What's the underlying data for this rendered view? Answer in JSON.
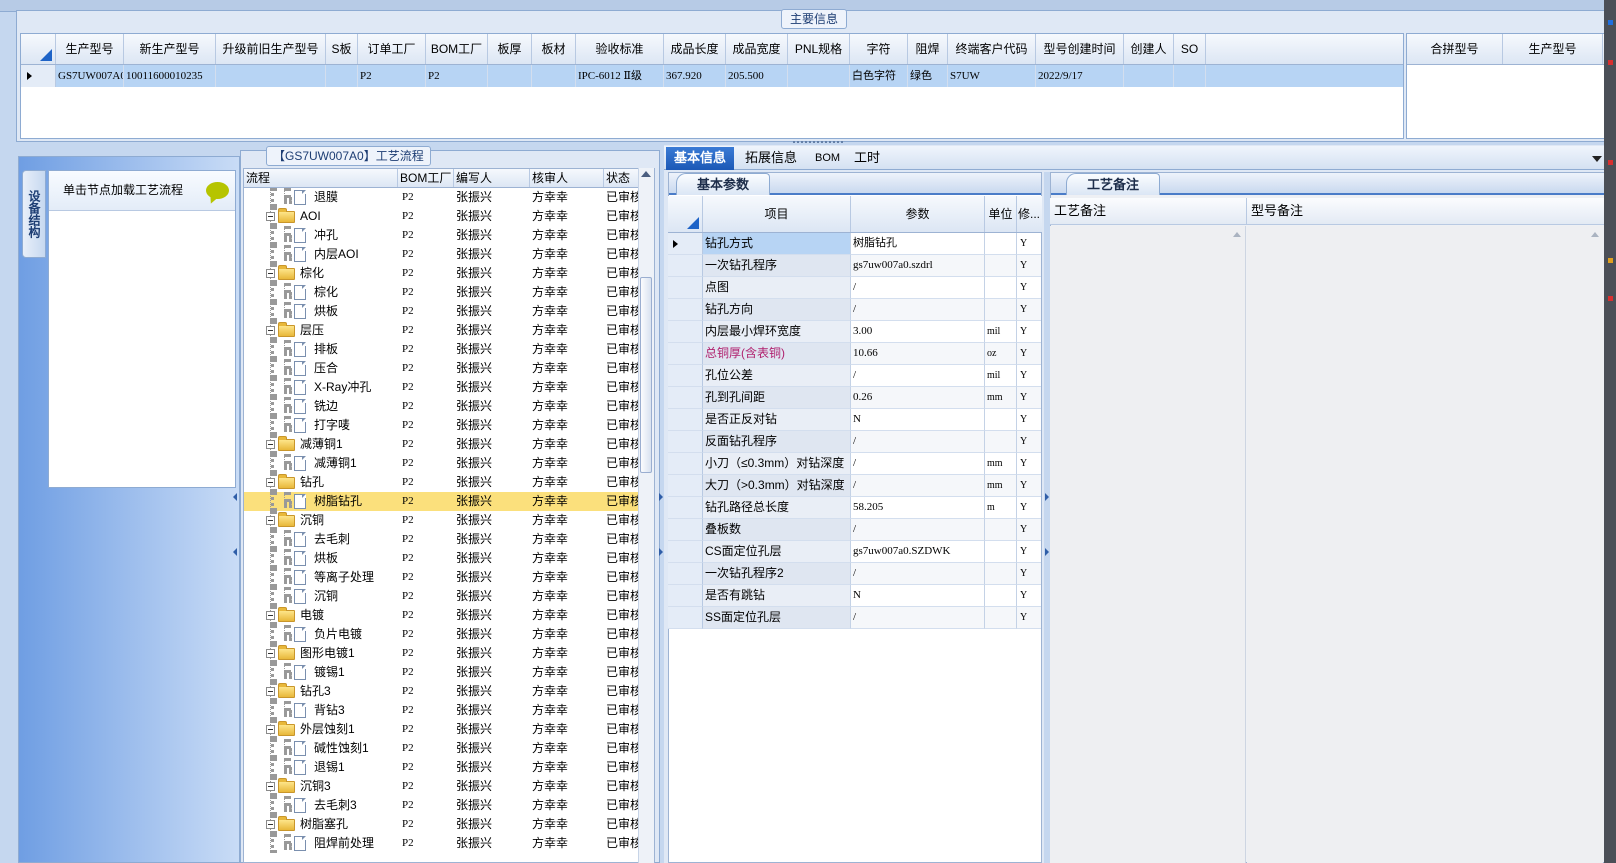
{
  "main_info": {
    "legend": "主要信息",
    "columns": [
      "生产型号",
      "新生产型号",
      "升级前旧生产型号",
      "S板",
      "订单工厂",
      "BOM工厂",
      "板厚",
      "板材",
      "验收标准",
      "成品长度",
      "成品宽度",
      "PNL规格",
      "字符",
      "阻焊",
      "终端客户代码",
      "型号创建时间",
      "创建人",
      "SO"
    ],
    "row": [
      "GS7UW007A0",
      "10011600010235",
      "",
      "",
      "P2",
      "P2",
      "",
      "",
      "IPC-6012 Ⅱ级",
      "367.920",
      "205.500",
      "",
      "白色字符",
      "绿色",
      "S7UW",
      "2022/9/17",
      "",
      ""
    ],
    "merge_columns": [
      "合拼型号",
      "生产型号"
    ]
  },
  "device_structure": {
    "tab_label": "设备结构",
    "hint": "单击节点加载工艺流程"
  },
  "process_flow": {
    "legend": "【GS7UW007A0】工艺流程",
    "columns": [
      "流程",
      "BOM工厂",
      "编写人",
      "核审人",
      "状态"
    ],
    "rows": [
      {
        "level": 1,
        "type": "doc",
        "name": "退膜",
        "bom": "P2",
        "writer": "张振兴",
        "reviewer": "方幸幸",
        "status": "已审核"
      },
      {
        "level": 0,
        "type": "folder",
        "name": "AOI",
        "bom": "P2",
        "writer": "张振兴",
        "reviewer": "方幸幸",
        "status": "已审核"
      },
      {
        "level": 1,
        "type": "doc",
        "name": "冲孔",
        "bom": "P2",
        "writer": "张振兴",
        "reviewer": "方幸幸",
        "status": "已审核"
      },
      {
        "level": 1,
        "type": "doc",
        "name": "内层AOI",
        "bom": "P2",
        "writer": "张振兴",
        "reviewer": "方幸幸",
        "status": "已审核"
      },
      {
        "level": 0,
        "type": "folder",
        "name": "棕化",
        "bom": "P2",
        "writer": "张振兴",
        "reviewer": "方幸幸",
        "status": "已审核"
      },
      {
        "level": 1,
        "type": "doc",
        "name": "棕化",
        "bom": "P2",
        "writer": "张振兴",
        "reviewer": "方幸幸",
        "status": "已审核"
      },
      {
        "level": 1,
        "type": "doc",
        "name": "烘板",
        "bom": "P2",
        "writer": "张振兴",
        "reviewer": "方幸幸",
        "status": "已审核"
      },
      {
        "level": 0,
        "type": "folder",
        "name": "层压",
        "bom": "P2",
        "writer": "张振兴",
        "reviewer": "方幸幸",
        "status": "已审核"
      },
      {
        "level": 1,
        "type": "doc",
        "name": "排板",
        "bom": "P2",
        "writer": "张振兴",
        "reviewer": "方幸幸",
        "status": "已审核"
      },
      {
        "level": 1,
        "type": "doc",
        "name": "压合",
        "bom": "P2",
        "writer": "张振兴",
        "reviewer": "方幸幸",
        "status": "已审核"
      },
      {
        "level": 1,
        "type": "doc",
        "name": "X-Ray冲孔",
        "bom": "P2",
        "writer": "张振兴",
        "reviewer": "方幸幸",
        "status": "已审核"
      },
      {
        "level": 1,
        "type": "doc",
        "name": "铣边",
        "bom": "P2",
        "writer": "张振兴",
        "reviewer": "方幸幸",
        "status": "已审核"
      },
      {
        "level": 1,
        "type": "doc",
        "name": "打字唛",
        "bom": "P2",
        "writer": "张振兴",
        "reviewer": "方幸幸",
        "status": "已审核"
      },
      {
        "level": 0,
        "type": "folder",
        "name": "减薄铜1",
        "bom": "P2",
        "writer": "张振兴",
        "reviewer": "方幸幸",
        "status": "已审核"
      },
      {
        "level": 1,
        "type": "doc",
        "name": "减薄铜1",
        "bom": "P2",
        "writer": "张振兴",
        "reviewer": "方幸幸",
        "status": "已审核"
      },
      {
        "level": 0,
        "type": "folder",
        "name": "钻孔",
        "bom": "P2",
        "writer": "张振兴",
        "reviewer": "方幸幸",
        "status": "已审核"
      },
      {
        "level": 1,
        "type": "doc",
        "name": "树脂钻孔",
        "bom": "P2",
        "writer": "张振兴",
        "reviewer": "方幸幸",
        "status": "已审核",
        "selected": true
      },
      {
        "level": 0,
        "type": "folder",
        "name": "沉铜",
        "bom": "P2",
        "writer": "张振兴",
        "reviewer": "方幸幸",
        "status": "已审核"
      },
      {
        "level": 1,
        "type": "doc",
        "name": "去毛刺",
        "bom": "P2",
        "writer": "张振兴",
        "reviewer": "方幸幸",
        "status": "已审核"
      },
      {
        "level": 1,
        "type": "doc",
        "name": "烘板",
        "bom": "P2",
        "writer": "张振兴",
        "reviewer": "方幸幸",
        "status": "已审核"
      },
      {
        "level": 1,
        "type": "doc",
        "name": "等离子处理",
        "bom": "P2",
        "writer": "张振兴",
        "reviewer": "方幸幸",
        "status": "已审核"
      },
      {
        "level": 1,
        "type": "doc",
        "name": "沉铜",
        "bom": "P2",
        "writer": "张振兴",
        "reviewer": "方幸幸",
        "status": "已审核"
      },
      {
        "level": 0,
        "type": "folder",
        "name": "电镀",
        "bom": "P2",
        "writer": "张振兴",
        "reviewer": "方幸幸",
        "status": "已审核"
      },
      {
        "level": 1,
        "type": "doc",
        "name": "负片电镀",
        "bom": "P2",
        "writer": "张振兴",
        "reviewer": "方幸幸",
        "status": "已审核"
      },
      {
        "level": 0,
        "type": "folder",
        "name": "图形电镀1",
        "bom": "P2",
        "writer": "张振兴",
        "reviewer": "方幸幸",
        "status": "已审核"
      },
      {
        "level": 1,
        "type": "doc",
        "name": "镀锡1",
        "bom": "P2",
        "writer": "张振兴",
        "reviewer": "方幸幸",
        "status": "已审核"
      },
      {
        "level": 0,
        "type": "folder",
        "name": "钻孔3",
        "bom": "P2",
        "writer": "张振兴",
        "reviewer": "方幸幸",
        "status": "已审核"
      },
      {
        "level": 1,
        "type": "doc",
        "name": "背钻3",
        "bom": "P2",
        "writer": "张振兴",
        "reviewer": "方幸幸",
        "status": "已审核"
      },
      {
        "level": 0,
        "type": "folder",
        "name": "外层蚀刻1",
        "bom": "P2",
        "writer": "张振兴",
        "reviewer": "方幸幸",
        "status": "已审核"
      },
      {
        "level": 1,
        "type": "doc",
        "name": "碱性蚀刻1",
        "bom": "P2",
        "writer": "张振兴",
        "reviewer": "方幸幸",
        "status": "已审核"
      },
      {
        "level": 1,
        "type": "doc",
        "name": "退锡1",
        "bom": "P2",
        "writer": "张振兴",
        "reviewer": "方幸幸",
        "status": "已审核"
      },
      {
        "level": 0,
        "type": "folder",
        "name": "沉铜3",
        "bom": "P2",
        "writer": "张振兴",
        "reviewer": "方幸幸",
        "status": "已审核"
      },
      {
        "level": 1,
        "type": "doc",
        "name": "去毛刺3",
        "bom": "P2",
        "writer": "张振兴",
        "reviewer": "方幸幸",
        "status": "已审核"
      },
      {
        "level": 0,
        "type": "folder",
        "name": "树脂塞孔",
        "bom": "P2",
        "writer": "张振兴",
        "reviewer": "方幸幸",
        "status": "已审核"
      },
      {
        "level": 1,
        "type": "doc",
        "name": "阻焊前处理",
        "bom": "P2",
        "writer": "张振兴",
        "reviewer": "方幸幸",
        "status": "已审核"
      }
    ]
  },
  "right_tabs": [
    "基本信息",
    "拓展信息",
    "BOM",
    "工时"
  ],
  "basic_params": {
    "tab_label": "基本参数",
    "columns": [
      "项目",
      "参数",
      "单位",
      "修..."
    ],
    "rows": [
      {
        "item": "钻孔方式",
        "value": "树脂钻孔",
        "unit": "",
        "mod": "Y",
        "current": true
      },
      {
        "item": "一次钻孔程序",
        "value": "gs7uw007a0.szdrl",
        "unit": "",
        "mod": "Y"
      },
      {
        "item": "点图",
        "value": "/",
        "unit": "",
        "mod": "Y"
      },
      {
        "item": "钻孔方向",
        "value": "/",
        "unit": "",
        "mod": "Y"
      },
      {
        "item": "内层最小焊环宽度",
        "value": "3.00",
        "unit": "mil",
        "mod": "Y"
      },
      {
        "item": "总铜厚(含表铜)",
        "value": "10.66",
        "unit": "oz",
        "mod": "Y",
        "highlight": true
      },
      {
        "item": "孔位公差",
        "value": "/",
        "unit": "mil",
        "mod": "Y"
      },
      {
        "item": "孔到孔间距",
        "value": "0.26",
        "unit": "mm",
        "mod": "Y"
      },
      {
        "item": "是否正反对钻",
        "value": "N",
        "unit": "",
        "mod": "Y"
      },
      {
        "item": "反面钻孔程序",
        "value": "/",
        "unit": "",
        "mod": "Y"
      },
      {
        "item": "小刀（≤0.3mm）对钻深度",
        "value": "/",
        "unit": "mm",
        "mod": "Y"
      },
      {
        "item": "大刀（>0.3mm）对钻深度",
        "value": "/",
        "unit": "mm",
        "mod": "Y"
      },
      {
        "item": "钻孔路径总长度",
        "value": "58.205",
        "unit": "m",
        "mod": "Y"
      },
      {
        "item": "叠板数",
        "value": "/",
        "unit": "",
        "mod": "Y"
      },
      {
        "item": "CS面定位孔层",
        "value": "gs7uw007a0.SZDWK",
        "unit": "",
        "mod": "Y"
      },
      {
        "item": "一次钻孔程序2",
        "value": "/",
        "unit": "",
        "mod": "Y"
      },
      {
        "item": "是否有跳钻",
        "value": "N",
        "unit": "",
        "mod": "Y"
      },
      {
        "item": "SS面定位孔层",
        "value": "/",
        "unit": "",
        "mod": "Y"
      }
    ]
  },
  "remarks": {
    "tab_label": "工艺备注",
    "columns": [
      "工艺备注",
      "型号备注"
    ]
  },
  "colors": {
    "highlight_text": "#b0206e",
    "selected_row": "#fbe07c",
    "active_tab": "#1b58b6"
  }
}
